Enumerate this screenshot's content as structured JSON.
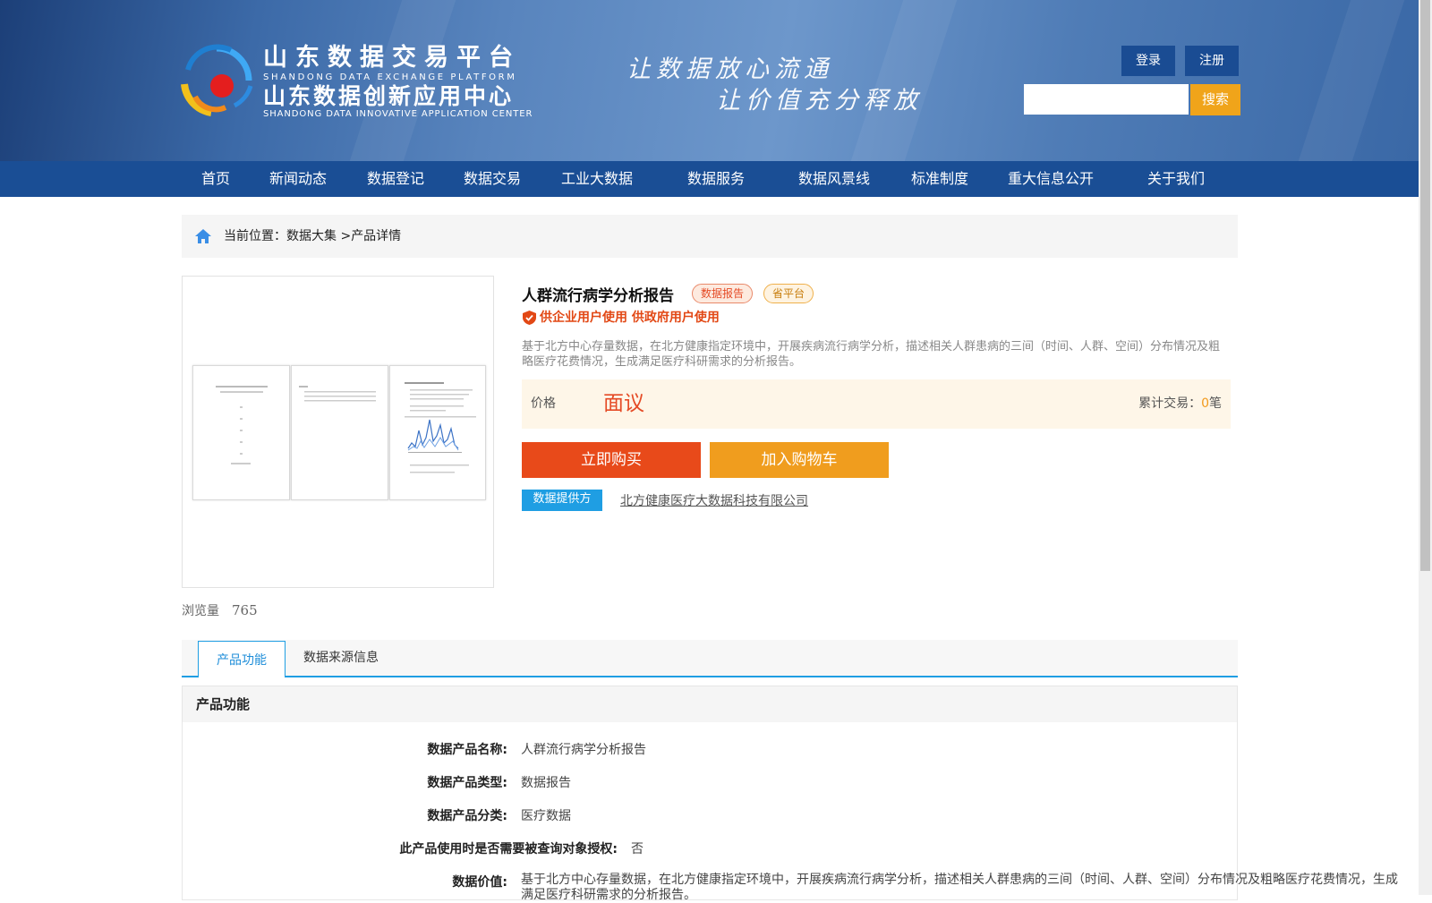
{
  "header": {
    "logo_cn_1": "山东数据交易平台",
    "logo_en_1": "SHANDONG DATA EXCHANGE PLATFORM",
    "logo_cn_2": "山东数据创新应用中心",
    "logo_en_2": "SHANDONG DATA INNOVATIVE APPLICATION CENTER",
    "slogan_1": "让数据放心流通",
    "slogan_2": "让价值充分释放",
    "login_label": "登录",
    "register_label": "注册",
    "search_placeholder": "",
    "search_button": "搜索"
  },
  "nav": {
    "items": [
      "首页",
      "新闻动态",
      "数据登记",
      "数据交易",
      "工业大数据",
      "数据服务",
      "数据风景线",
      "标准制度",
      "重大信息公开",
      "关于我们"
    ]
  },
  "breadcrumb": {
    "prefix": "当前位置：",
    "parent": "数据大集",
    "separator": ">",
    "current": "产品详情"
  },
  "product": {
    "views_label": "浏览量",
    "views_count": "765",
    "title": "人群流行病学分析报告",
    "tag_type": "数据报告",
    "tag_platform": "省平台",
    "usage": "供企业用户使用 供政府用户使用",
    "description": "基于北方中心存量数据，在北方健康指定环境中，开展疾病流行病学分析，描述相关人群患病的三间（时间、人群、空间）分布情况及粗略医疗花费情况，生成满足医疗科研需求的分析报告。",
    "price_label": "价格",
    "price_value": "面议",
    "trade_label": "累计交易：",
    "trade_count": "0",
    "trade_unit": "笔",
    "buy_button": "立即购买",
    "cart_button": "加入购物车",
    "provider_label": "数据提供方",
    "provider_name": "北方健康医疗大数据科技有限公司"
  },
  "tabs": {
    "function": "产品功能",
    "source": "数据来源信息"
  },
  "function_section": {
    "heading": "产品功能",
    "rows": [
      {
        "label": "数据产品名称:",
        "value": "人群流行病学分析报告"
      },
      {
        "label": "数据产品类型:",
        "value": "数据报告"
      },
      {
        "label": "数据产品分类:",
        "value": "医疗数据"
      },
      {
        "label": "此产品使用时是否需要被查询对象授权:",
        "value": "否"
      },
      {
        "label": "数据价值:",
        "value": "基于北方中心存量数据，在北方健康指定环境中，开展疾病流行病学分析，描述相关人群患病的三间（时间、人群、空间）分布情况及粗略医疗花费情况，生成满足医疗科研需求的分析报告。"
      }
    ]
  },
  "colors": {
    "nav_bg": "#1a4e95",
    "accent_blue": "#1f9ee3",
    "buy_red": "#e84a1a",
    "cart_orange": "#f09d1e",
    "search_orange": "#f0a41a"
  }
}
